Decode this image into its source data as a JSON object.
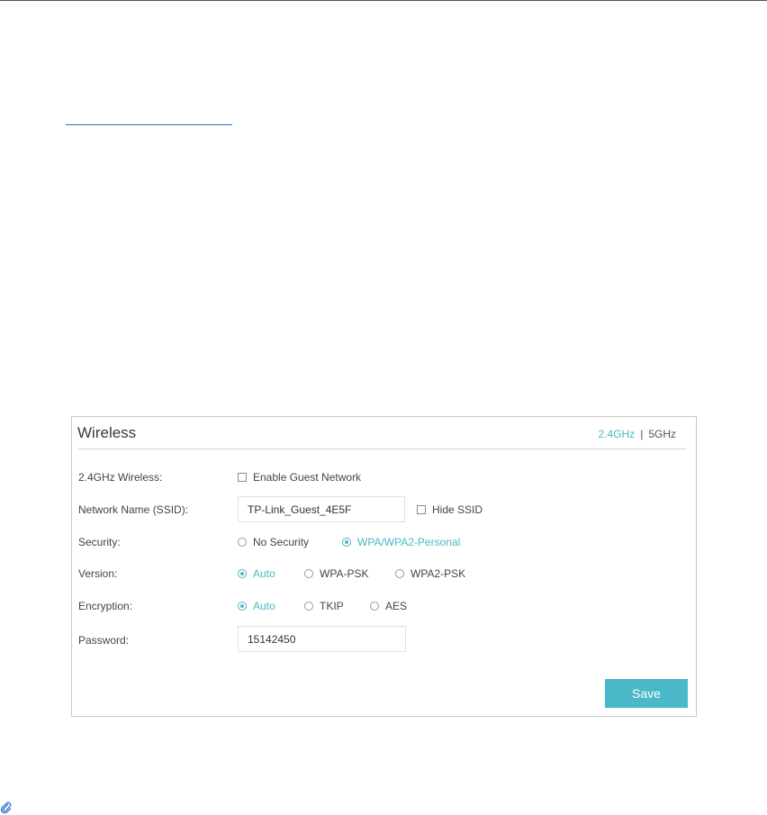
{
  "panel": {
    "title": "Wireless",
    "bands": {
      "active": "2.4GHz",
      "separator": "|",
      "other": "5GHz"
    }
  },
  "rows": {
    "wireless": {
      "label": "2.4GHz Wireless:",
      "checkbox_label": "Enable Guest Network"
    },
    "ssid": {
      "label": "Network Name (SSID):",
      "value": "TP-Link_Guest_4E5F",
      "hide_label": "Hide SSID"
    },
    "security": {
      "label": "Security:",
      "options": [
        "No Security",
        "WPA/WPA2-Personal"
      ],
      "selected": "WPA/WPA2-Personal"
    },
    "version": {
      "label": "Version:",
      "options": [
        "Auto",
        "WPA-PSK",
        "WPA2-PSK"
      ],
      "selected": "Auto"
    },
    "encryption": {
      "label": "Encryption:",
      "options": [
        "Auto",
        "TKIP",
        "AES"
      ],
      "selected": "Auto"
    },
    "password": {
      "label": "Password:",
      "value": "15142450"
    }
  },
  "save_label": "Save",
  "colors": {
    "accent": "#4ab8c8",
    "link": "#2a6fc2",
    "border": "#c8c8c8"
  },
  "icons": {
    "note": "paperclip-icon"
  }
}
